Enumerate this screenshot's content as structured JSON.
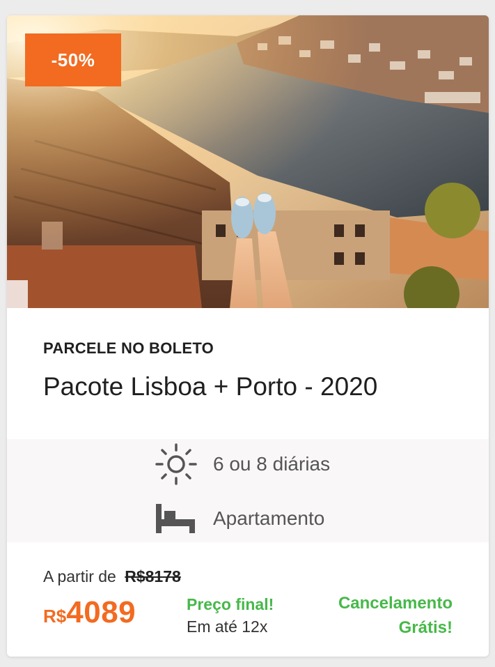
{
  "badge": {
    "discount": "-50%"
  },
  "hero": {
    "image": "porto-river-view-photo"
  },
  "package": {
    "tag": "PARCELE NO BOLETO",
    "title": "Pacote Lisboa + Porto - 2020"
  },
  "features": [
    {
      "icon": "sun-icon",
      "label": "6 ou 8 diárias"
    },
    {
      "icon": "bed-icon",
      "label": "Apartamento"
    }
  ],
  "pricing": {
    "from_label": "A partir de",
    "old_price": "R$8178",
    "currency": "R$",
    "amount": "4089",
    "final_label": "Preço final!",
    "installments": "Em até 12x",
    "cancellation_line1": "Cancelamento",
    "cancellation_line2": "Grátis!"
  },
  "colors": {
    "accent": "#f26b21",
    "success": "#47b84a",
    "text": "#1f1f1f",
    "muted": "#555555"
  }
}
